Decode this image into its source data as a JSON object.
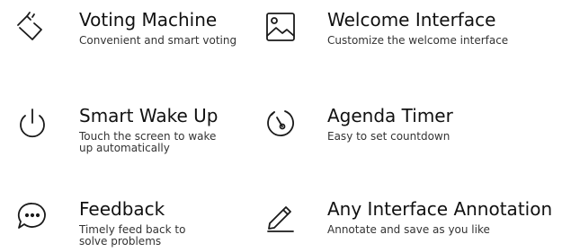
{
  "features": [
    {
      "icon": "vote-hand-icon",
      "title": "Voting Machine",
      "description": "Convenient and smart voting"
    },
    {
      "icon": "image-icon",
      "title": "Welcome Interface",
      "description": "Customize the welcome interface"
    },
    {
      "icon": "power-icon",
      "title": "Smart Wake Up",
      "description": "Touch the screen to wake\nup automatically"
    },
    {
      "icon": "timer-icon",
      "title": "Agenda Timer",
      "description": "Easy to set countdown"
    },
    {
      "icon": "chat-bubble-icon",
      "title": "Feedback",
      "description": "Timely feed back to\nsolve problems"
    },
    {
      "icon": "pencil-icon",
      "title": "Any Interface Annotation",
      "description": "Annotate and save as you like"
    }
  ]
}
